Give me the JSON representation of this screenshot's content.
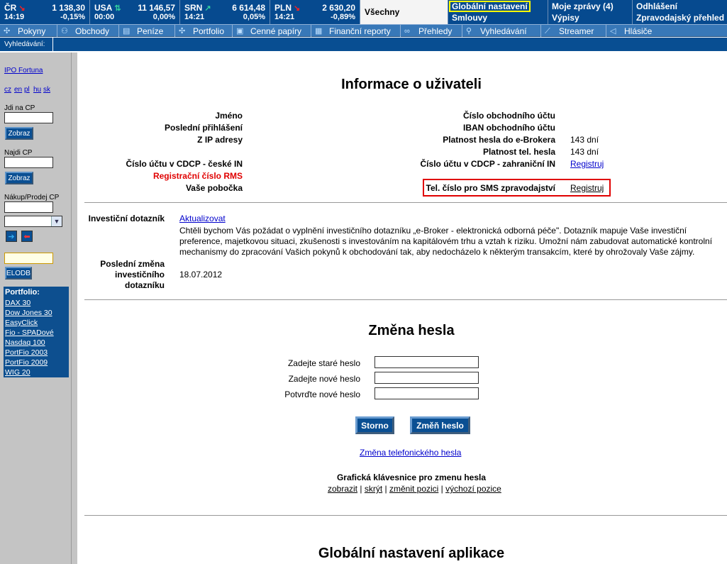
{
  "ticker": [
    {
      "name": "ČR",
      "dir": "down",
      "value": "1 138,30",
      "time": "14:19",
      "change": "-0,15%"
    },
    {
      "name": "USA",
      "dir": "mixed",
      "value": "11 146,57",
      "time": "00:00",
      "change": "0,00%"
    },
    {
      "name": "SRN",
      "dir": "up",
      "value": "6 614,48",
      "time": "14:21",
      "change": "0,05%"
    },
    {
      "name": "PLN",
      "dir": "down",
      "value": "2 630,20",
      "time": "14:21",
      "change": "-0,89%"
    }
  ],
  "topbar": {
    "all": "Všechny",
    "global": "Globální nastavení",
    "contracts": "Smlouvy",
    "messages": "Moje zprávy (4)",
    "statements": "Výpisy",
    "logout": "Odhlášení",
    "news": "Zpravodajský přehled"
  },
  "menu": [
    "Pokyny",
    "Obchody",
    "Peníze",
    "Portfolio",
    "Cenné papíry",
    "Finanční reporty",
    "Přehledy",
    "Vyhledávání",
    "Streamer",
    "Hlásiče"
  ],
  "search_label": "Vyhledávání:",
  "sidebar": {
    "ipo": "IPO Fortuna",
    "langs": [
      "cz",
      "en",
      "pl",
      "hu",
      "sk"
    ],
    "goto": "Jdi na CP",
    "show": "Zobraz",
    "find": "Najdi CP",
    "trade": "Nákup/Prodej CP",
    "elodb": "ELODB"
  },
  "portfolio": {
    "heading": "Portfolio:",
    "items": [
      "DAX 30",
      "Dow Jones 30",
      "EasyClick",
      "Fio - SPADové",
      "Nasdaq 100",
      "PortFio 2003",
      "PortFio 2009",
      "WIG 20"
    ]
  },
  "user": {
    "title": "Informace o uživateli",
    "left": [
      "Jméno",
      "Poslední přihlášení",
      "Z IP adresy",
      "",
      "Číslo účtu v CDCP - české IN",
      "Registrační číslo RMS",
      "Vaše pobočka"
    ],
    "right": [
      "Číslo obchodního účtu",
      "IBAN obchodního účtu",
      "Platnost hesla do e-Brokera",
      "Platnost tel. hesla",
      "Číslo účtu v CDCP - zahraniční IN"
    ],
    "pwd_valid": "143 dní",
    "tel_valid": "143 dní",
    "register": "Registruj",
    "sms": "Tel. číslo pro SMS zpravodajství"
  },
  "quest": {
    "label": "Investiční dotazník",
    "update": "Aktualizovat",
    "lines": [
      "Chtěli bychom Vás požádat o vyplnění investičního dotazníku „e-Broker - elektronická odborná péče\". Dotazník mapuje Vaše investiční",
      "preference, majetkovou situaci, zkušenosti s investováním na kapitálovém trhu a vztah k riziku. Umožní nám zabudovat automatické kontrolní",
      "mechanismy do zpracování Vašich pokynů k obchodování tak, aby nedocházelo k některým transakcím, které by ohrožovaly Vaše zájmy."
    ],
    "last_change": [
      "Poslední změna",
      "investičního",
      "dotazníku"
    ],
    "date": "18.07.2012"
  },
  "pwd": {
    "title": "Změna hesla",
    "old": "Zadejte staré heslo",
    "new": "Zadejte nové heslo",
    "confirm": "Potvrďte nové heslo",
    "cancel": "Storno",
    "change": "Změň heslo",
    "tel_change": "Změna telefonického hesla",
    "keyboard": "Grafická klávesnice pro zmenu hesla",
    "kb_links": [
      "zobrazit",
      "skrýt",
      "změnit pozici",
      "výchozí pozice"
    ]
  },
  "global_title": "Globální nastavení aplikace"
}
